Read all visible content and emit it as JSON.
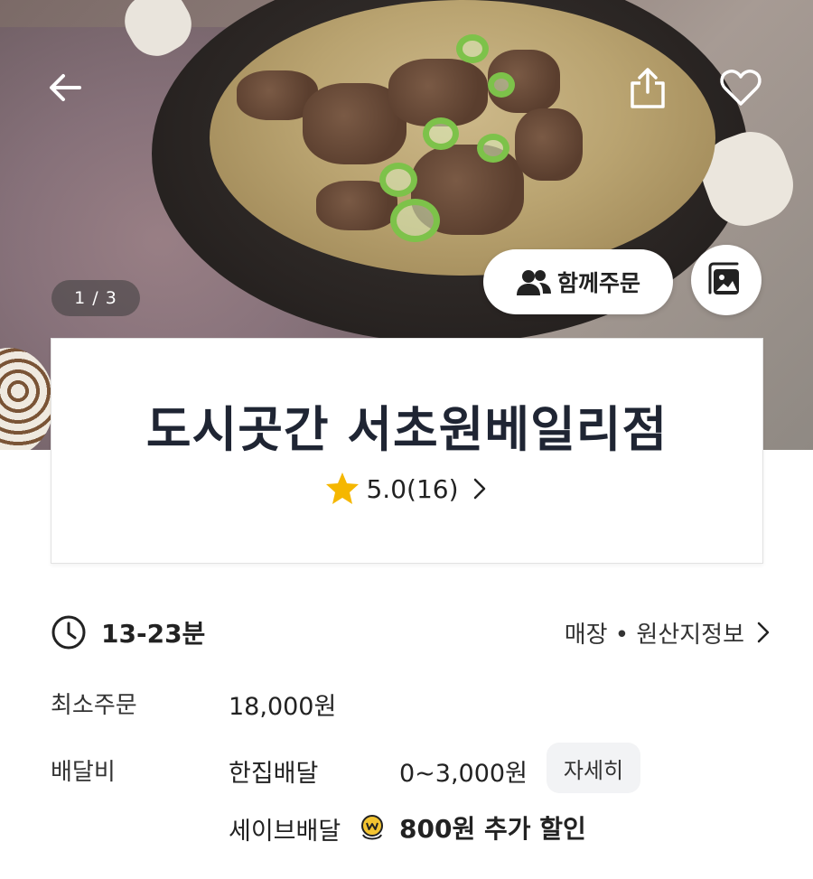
{
  "hero": {
    "page_indicator": "1 / 3",
    "group_order_label": "함께주문"
  },
  "store": {
    "name": "도시곳간 서초원베일리점",
    "rating": "5.0(16)"
  },
  "delivery": {
    "time": "13-23분",
    "store_info_link": "매장 • 원산지정보",
    "min_order_label": "최소주문",
    "min_order_value": "18,000원",
    "fee_label": "배달비",
    "fee_type": "한집배달",
    "fee_range": "0~3,000원",
    "detail_button": "자세히",
    "save_delivery_label": "세이브배달",
    "save_discount": "800원 추가 할인"
  },
  "colors": {
    "star": "#f5b700",
    "title_text": "#1f2533",
    "detail_button_bg": "#f2f3f5"
  },
  "icons": [
    "back-arrow-icon",
    "share-icon",
    "heart-icon",
    "people-icon",
    "gallery-icon",
    "star-icon",
    "chevron-right-icon",
    "clock-icon",
    "save-coin-icon"
  ]
}
